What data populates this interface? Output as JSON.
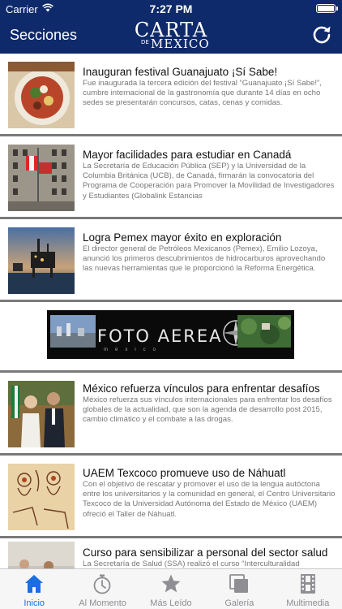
{
  "status_bar": {
    "carrier": "Carrier",
    "time": "7:27 PM"
  },
  "header": {
    "left_label": "Secciones",
    "logo_top": "CARTA",
    "logo_de": "DE",
    "logo_bottom": "MEXICO",
    "refresh_icon": "refresh-icon",
    "background": "#0f2a6b"
  },
  "articles": [
    {
      "title": "Inauguran festival Guanajuato ¡Sí Sabe!",
      "description": "Fue inaugurada la tercera edición del festival “Guanajuato ¡Sí Sabe!”, cumbre internacional de la gastronomía que durante 14 días en ocho sedes se presentarán concursos, catas, cenas y comidas."
    },
    {
      "title": "Mayor facilidades para estudiar en Canadá",
      "description": "La Secretaría de Educación Pública (SEP) y la Universidad de la Columbia Británica (UCB), de Canadá, firmarán la convocatoria del Programa de Cooperación para Promover la Movilidad de Investigadores y Estudiantes (Globalink Estancias"
    },
    {
      "title": "Logra Pemex mayor éxito en exploración",
      "description": "El director general de Petróleos Mexicanos (Pemex), Emilio Lozoya, anunció los primeros descubrimientos de hidrocarburos aprovechando las nuevas herramientas que le proporcionó la Reforma Energética."
    },
    {
      "title": "México refuerza vínculos para enfrentar desafíos",
      "description": "México refuerza sus vínculos internacionales para enfrentar los desafíos globales de la actualidad, que son la agenda de desarrollo post 2015, cambio climático y el combate a las drogas."
    },
    {
      "title": "UAEM Texcoco promueve uso de Náhuatl",
      "description": "Con el objetivo de rescatar y promover el uso de la lengua autóctona entre los universitarios y la comunidad en general, el Centro Universitario Texcoco de la Universidad Autónoma del Estado de México (UAEM) ofreció el Taller de Náhuatl."
    },
    {
      "title": "Curso para sensibilizar a personal del sector salud",
      "description": "La Secretaría de Salud (SSA) realizó el curso “Interculturalidad"
    }
  ],
  "ad": {
    "title": "FOTO AEREA",
    "subtitle": "méxico"
  },
  "tabs": [
    {
      "label": "Inicio",
      "icon": "home-icon",
      "active": true
    },
    {
      "label": "Al Momento",
      "icon": "stopwatch-icon",
      "active": false
    },
    {
      "label": "Más Leído",
      "icon": "star-icon",
      "active": false
    },
    {
      "label": "Galería",
      "icon": "gallery-icon",
      "active": false
    },
    {
      "label": "Multimedia",
      "icon": "film-icon",
      "active": false
    }
  ],
  "colors": {
    "accent": "#1a6fe0",
    "inactive": "#8e8e93",
    "divider": "#7a7a7a"
  }
}
